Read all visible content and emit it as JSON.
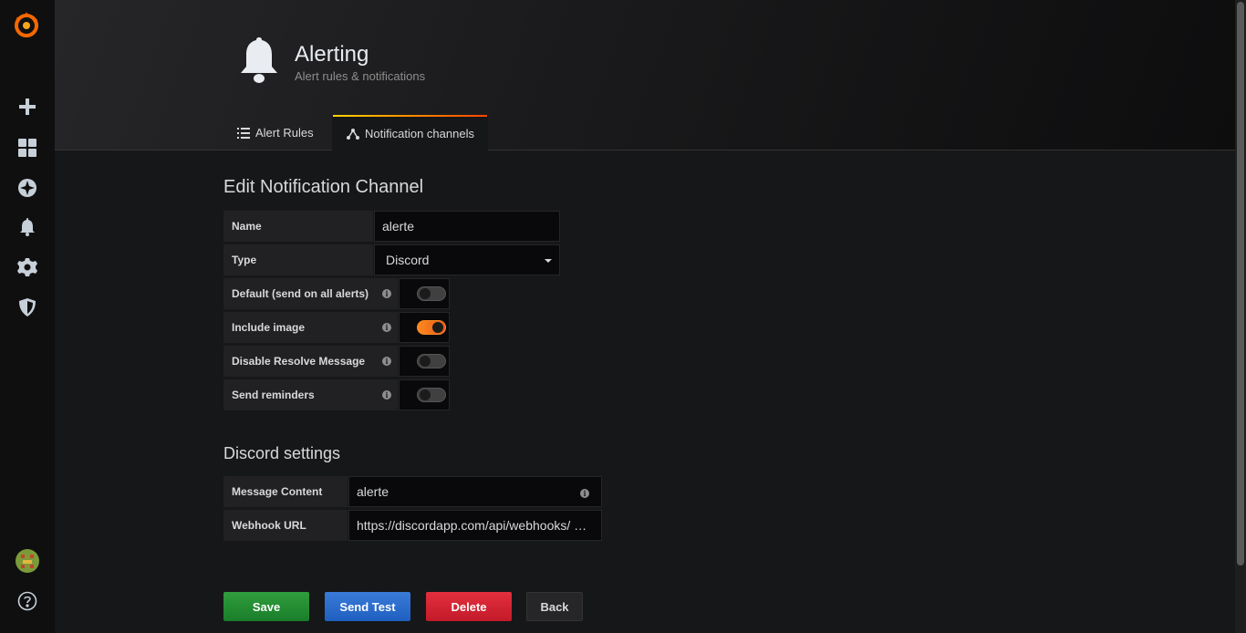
{
  "header": {
    "title": "Alerting",
    "subtitle": "Alert rules & notifications"
  },
  "tabs": [
    {
      "label": "Alert Rules",
      "icon": "list-icon",
      "active": false
    },
    {
      "label": "Notification channels",
      "icon": "share-nodes-icon",
      "active": true
    }
  ],
  "sidebar": {
    "items": [
      "grafana-logo",
      "plus-icon",
      "dashboards-icon",
      "explore-icon",
      "bell-icon",
      "gear-icon",
      "shield-icon",
      "avatar",
      "help-icon"
    ]
  },
  "form": {
    "heading": "Edit Notification Channel",
    "name_label": "Name",
    "name_value": "alerte",
    "type_label": "Type",
    "type_value": "Discord",
    "toggles": [
      {
        "label": "Default (send on all alerts)",
        "on": false
      },
      {
        "label": "Include image",
        "on": true
      },
      {
        "label": "Disable Resolve Message",
        "on": false
      },
      {
        "label": "Send reminders",
        "on": false
      }
    ]
  },
  "discord": {
    "heading": "Discord settings",
    "message_label": "Message Content",
    "message_value": "alerte",
    "webhook_label": "Webhook URL",
    "webhook_value": "https://discordapp.com/api/webhooks/ …"
  },
  "buttons": {
    "save": "Save",
    "send_test": "Send Test",
    "delete": "Delete",
    "back": "Back"
  },
  "colors": {
    "save": "#1a7d2a",
    "send_test": "#1f5fc0",
    "delete": "#c21a2a",
    "toggle_on": "#ff8a1f"
  }
}
